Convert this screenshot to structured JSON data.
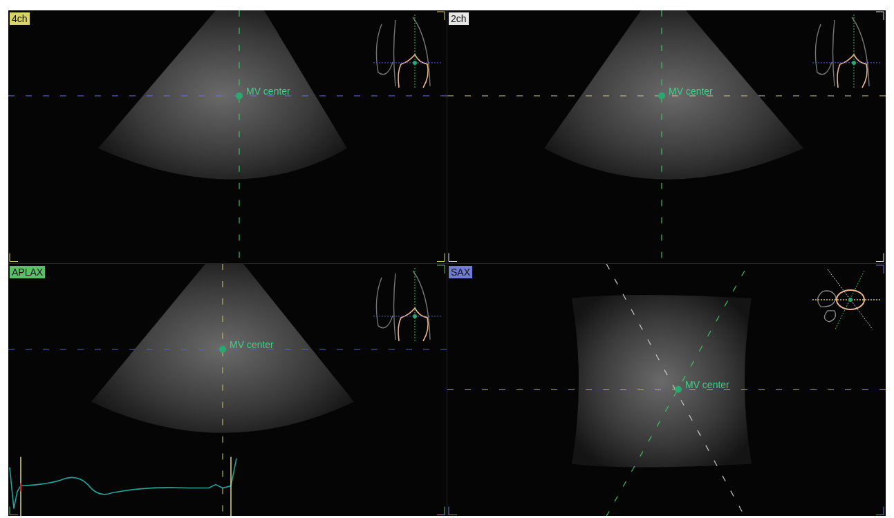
{
  "views": [
    {
      "label": "4ch",
      "color": "#d9d36a",
      "kind": "sector",
      "marker": "MV center"
    },
    {
      "label": "2ch",
      "color": "#e6e6e6",
      "kind": "sector",
      "marker": "MV center"
    },
    {
      "label": "APLAX",
      "color": "#5cbf68",
      "kind": "sector",
      "marker": "MV center"
    },
    {
      "label": "SAX",
      "color": "#6f7cd2",
      "kind": "sax",
      "marker": "MV center"
    }
  ]
}
